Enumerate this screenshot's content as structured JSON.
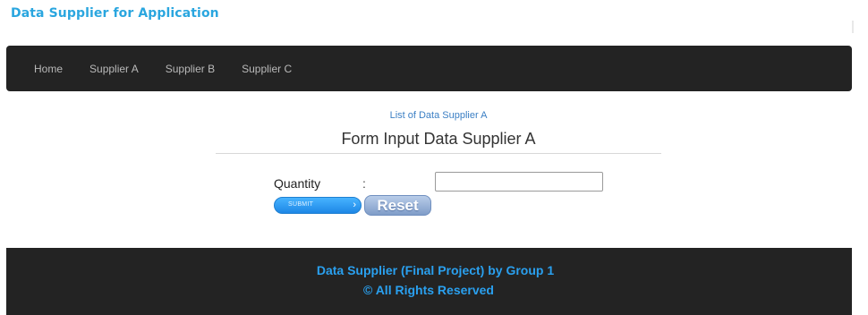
{
  "header": {
    "brand": "Data Supplier for Application"
  },
  "nav": {
    "items": [
      {
        "label": "Home"
      },
      {
        "label": "Supplier A"
      },
      {
        "label": "Supplier B"
      },
      {
        "label": "Supplier C"
      }
    ]
  },
  "main": {
    "list_link": "List of Data Supplier A",
    "form_title": "Form Input Data Supplier A",
    "quantity_label": "Quantity",
    "colon": ":",
    "quantity_value": "",
    "submit_label": "SUBMIT",
    "submit_arrow": "›",
    "reset_label": "Reset"
  },
  "footer": {
    "line1": "Data Supplier (Final Project) by Group 1",
    "line2": "© All Rights Reserved"
  },
  "colors": {
    "brand": "#2aa6df",
    "navbar_bg": "#232323",
    "submit_blue": "#1d87e6",
    "reset_blue": "#7f9cc8",
    "footer_text": "#2aa0ef"
  }
}
